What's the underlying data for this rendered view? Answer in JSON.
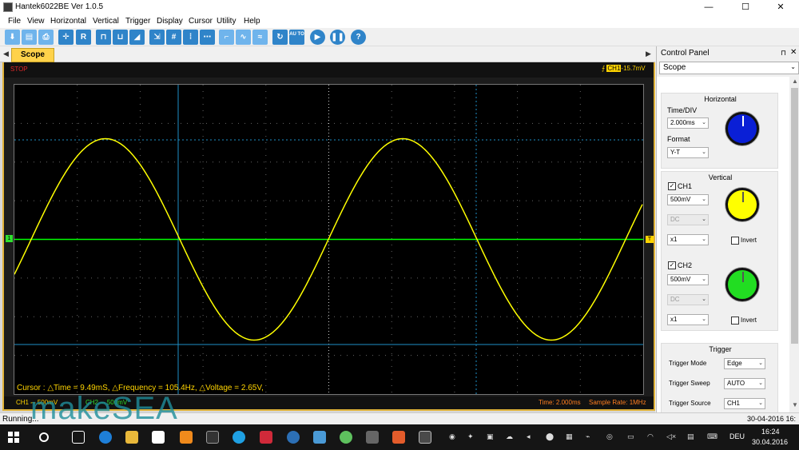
{
  "window": {
    "title": "Hantek6022BE Ver 1.0.5",
    "minimize": "—",
    "maximize": "☐",
    "close": "✕"
  },
  "menu": [
    "File",
    "View",
    "Horizontal",
    "Vertical",
    "Trigger",
    "Display",
    "Cursor",
    "Utility",
    "Help"
  ],
  "toolbar": {
    "buttons": [
      "save-icon",
      "print-icon",
      "cursor-cross-icon",
      "R",
      "square-wave-icon",
      "pulse-icon",
      "ramp-icon",
      "cursor-h-icon",
      "grid-icon",
      "cursor-v-icon",
      "dots-icon",
      "step-icon",
      "sine-icon",
      "wave-icon",
      "refresh-icon",
      "AUTO",
      "play-icon",
      "pause-icon",
      "help-icon"
    ],
    "r_label": "R",
    "auto_label": "AU TO",
    "help_label": "?"
  },
  "scope": {
    "tab_label": "Scope",
    "run_state": "STOP",
    "trigger_channel": "CH1",
    "trigger_level": "-15.7mV",
    "cursor_readout": "Cursor : △Time = 9.49mS, △Frequency = 105.4Hz, △Voltage = 2.65V,",
    "ch1_info": "CH1 ⎓ 500mV",
    "ch2_info": "CH2 ⎓ 500mV",
    "time_info": "Time: 2.000ms",
    "rate_info": "Sample Rate: 1MHz",
    "ch1_marker": "1",
    "trigger_marker": "T",
    "colors": {
      "ch1": "#ffff00",
      "ch2": "#00ff00",
      "cursor": "#1e90c8",
      "grid": "#cccccc"
    }
  },
  "control_panel": {
    "title": "Control Panel",
    "pin": "⊓",
    "close": "✕",
    "selected": "Scope",
    "horizontal": {
      "title": "Horizontal",
      "time_div_label": "Time/DIV",
      "time_div_value": "2.000ms",
      "format_label": "Format",
      "format_value": "Y-T"
    },
    "vertical": {
      "title": "Vertical",
      "ch1_label": "CH1",
      "ch1_volt": "500mV",
      "ch1_coupling": "DC",
      "ch1_probe": "x1",
      "ch1_invert": "Invert",
      "ch2_label": "CH2",
      "ch2_volt": "500mV",
      "ch2_coupling": "DC",
      "ch2_probe": "x1",
      "ch2_invert": "Invert"
    },
    "trigger": {
      "title": "Trigger",
      "mode_label": "Trigger Mode",
      "mode_value": "Edge",
      "sweep_label": "Trigger Sweep",
      "sweep_value": "AUTO",
      "source_label": "Trigger Source",
      "source_value": "CH1"
    }
  },
  "statusbar": {
    "text": "Running...",
    "date": "30-04-2016  16:"
  },
  "watermark": "makeSEA",
  "taskbar": {
    "language": "DEU",
    "time": "16:24",
    "date": "30.04.2016"
  }
}
